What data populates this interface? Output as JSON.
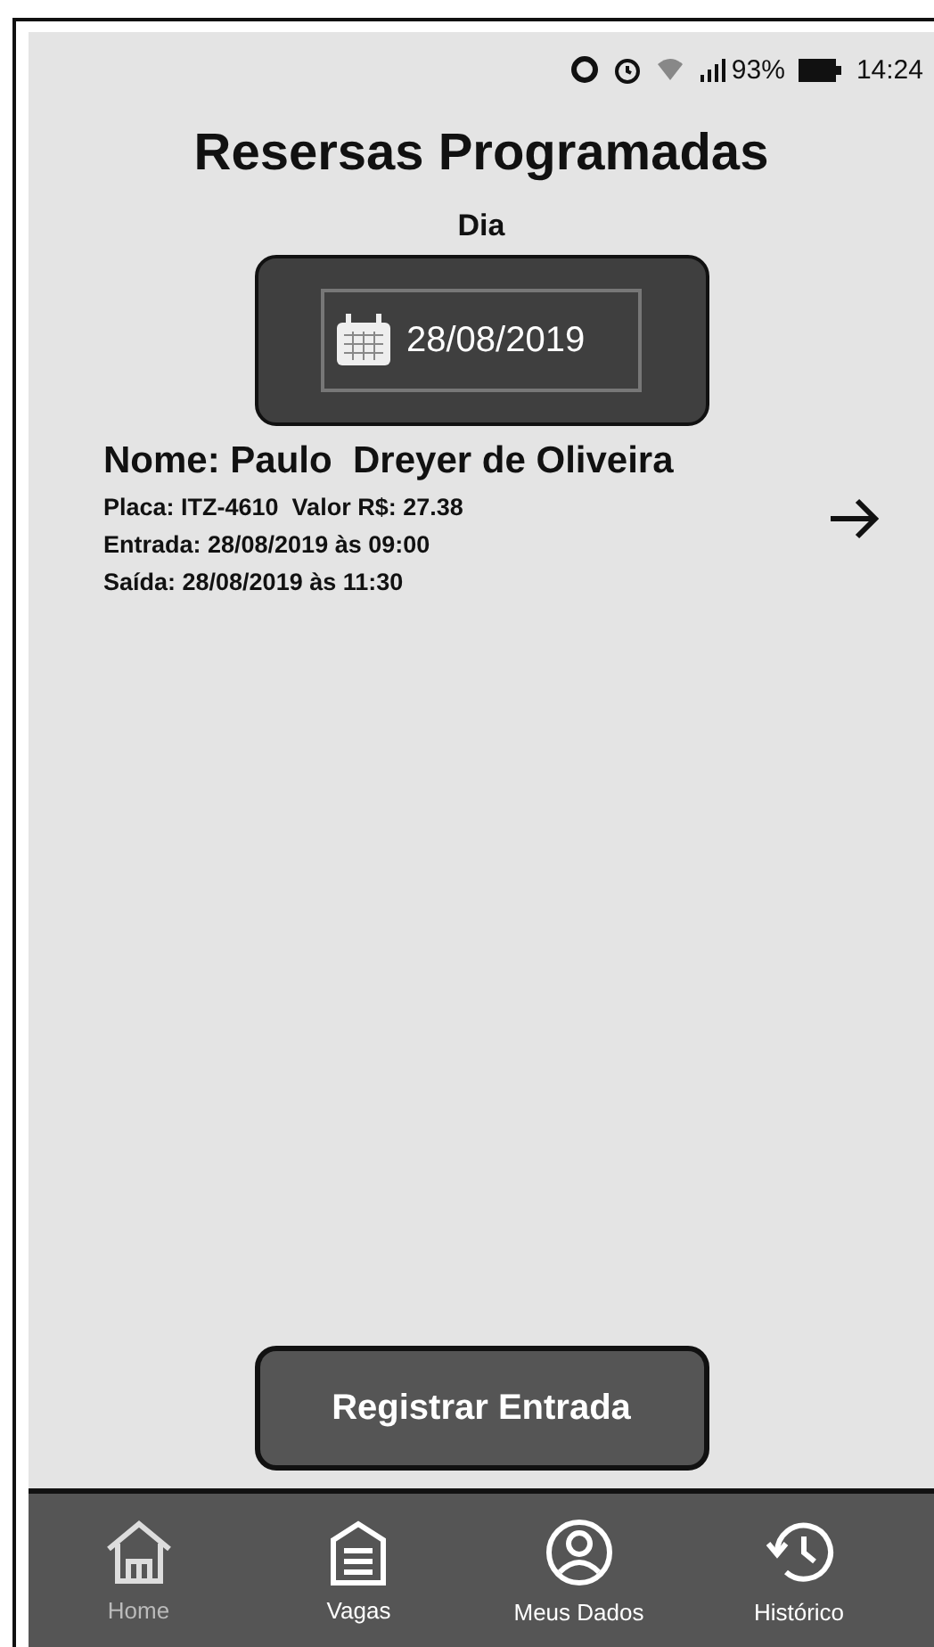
{
  "status_bar": {
    "battery": "93%",
    "time": "14:24"
  },
  "title": "Resersas Programadas",
  "date_picker": {
    "label": "Dia",
    "value": "28/08/2019"
  },
  "reservation": {
    "name": "Nome: Paulo  Dreyer de Oliveira",
    "plate_value": "Placa: ITZ-4610  Valor R$: 27.38",
    "entry": "Entrada: 28/08/2019 às 09:00",
    "exit": "Saída: 28/08/2019 às 11:30"
  },
  "action_button": "Registrar Entrada",
  "nav": [
    {
      "kind": "home",
      "label": "Home",
      "selected": true
    },
    {
      "kind": "garage",
      "label": "Vagas",
      "selected": false
    },
    {
      "kind": "person",
      "label": "Meus Dados",
      "selected": false
    },
    {
      "kind": "history",
      "label": "Histórico",
      "selected": false
    }
  ]
}
